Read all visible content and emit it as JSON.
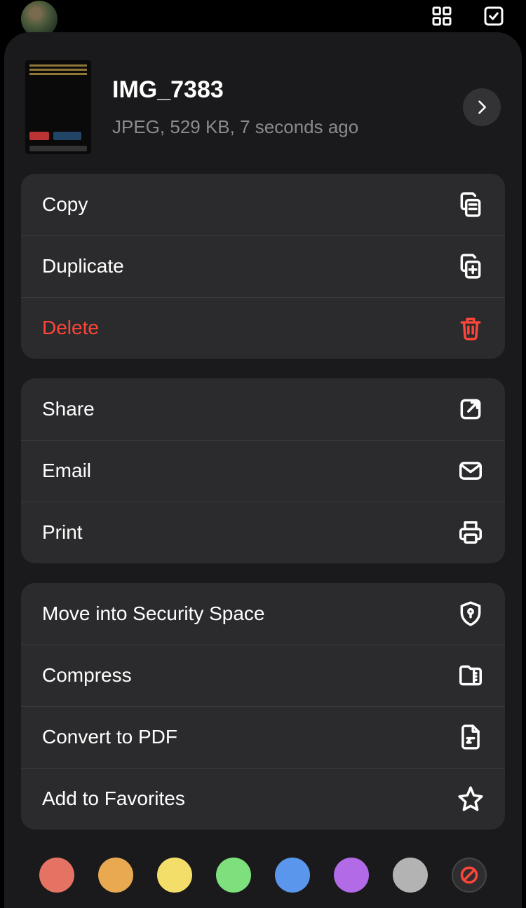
{
  "header": {
    "title": "IMG_7383",
    "subtitle": "JPEG, 529 KB, 7 seconds ago"
  },
  "groups": [
    {
      "items": [
        {
          "label": "Copy",
          "icon": "copy-icon",
          "danger": false
        },
        {
          "label": "Duplicate",
          "icon": "duplicate-icon",
          "danger": false
        },
        {
          "label": "Delete",
          "icon": "trash-icon",
          "danger": true
        }
      ]
    },
    {
      "items": [
        {
          "label": "Share",
          "icon": "share-icon",
          "danger": false
        },
        {
          "label": "Email",
          "icon": "email-icon",
          "danger": false
        },
        {
          "label": "Print",
          "icon": "print-icon",
          "danger": false
        }
      ]
    },
    {
      "items": [
        {
          "label": "Move into Security Space",
          "icon": "shield-lock-icon",
          "danger": false
        },
        {
          "label": "Compress",
          "icon": "compress-icon",
          "danger": false
        },
        {
          "label": "Convert to PDF",
          "icon": "convert-pdf-icon",
          "danger": false
        },
        {
          "label": "Add to Favorites",
          "icon": "star-icon",
          "danger": false
        }
      ]
    }
  ],
  "tagColors": [
    "#e57363",
    "#e8a951",
    "#f4de6a",
    "#7de07d",
    "#5a96eb",
    "#b36ae6",
    "#b3b3b3"
  ]
}
